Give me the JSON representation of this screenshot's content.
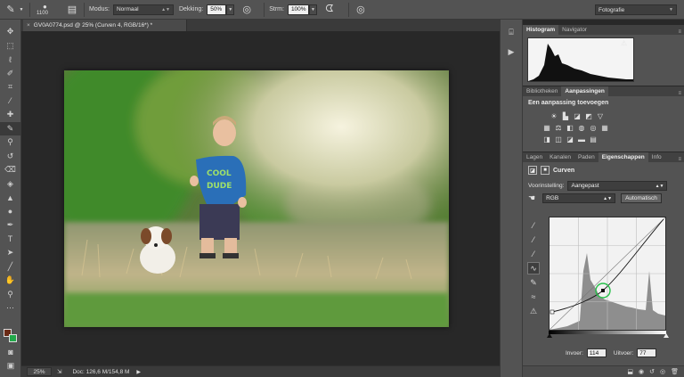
{
  "options_bar": {
    "brush_size": "1100",
    "mode_label": "Modus:",
    "mode_value": "Normaal",
    "opacity_label": "Dekking:",
    "opacity_value": "50%",
    "flow_label": "Strm:",
    "flow_value": "100%",
    "workspace": "Fotografie"
  },
  "document": {
    "tab_title": "GV0A0774.psd @ 25% (Curven 4, RGB/16*) *",
    "close_symbol": "×",
    "zoom": "25%",
    "doc_info": "Doc: 126,6 M/154,8 M"
  },
  "histogram_panel": {
    "tabs": [
      "Histogram",
      "Navigator"
    ],
    "active_tab": 0,
    "warning_glyph": "⚠"
  },
  "adjustments_panel": {
    "tabs": [
      "Bibliotheken",
      "Aanpassingen"
    ],
    "active_tab": 1,
    "title": "Een aanpassing toevoegen"
  },
  "properties_panel": {
    "tabs": [
      "Lagen",
      "Kanalen",
      "Paden",
      "Eigenschappen",
      "Info"
    ],
    "active_tab": 3,
    "layer_type": "Curven",
    "preset_label": "Voorinstelling:",
    "preset_value": "Aangepast",
    "channel_value": "RGB",
    "auto_button": "Automatisch",
    "input_label": "Invoer:",
    "input_value": "114",
    "output_label": "Uitvoer:",
    "output_value": "77"
  },
  "colors": {
    "foreground": "#6a2a16",
    "background": "#22a84a",
    "panel": "#535353",
    "canvas_bg": "#282828"
  }
}
